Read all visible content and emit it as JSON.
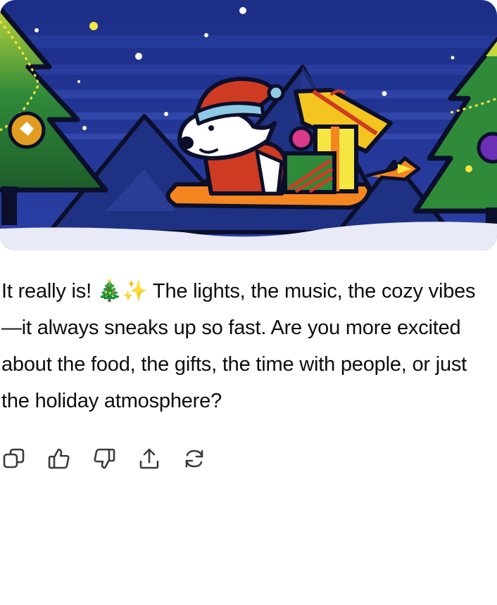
{
  "banner": {
    "icon": "christmas-sleigh-illustration"
  },
  "message": {
    "text": "It really is! 🎄✨ The lights, the music, the cozy vibes—it always sneaks up so fast. Are you more excited about the food, the gifts, the time with people, or just the holiday atmosphere?"
  },
  "actions": [
    {
      "icon": "copy-icon"
    },
    {
      "icon": "thumbs-up-icon"
    },
    {
      "icon": "thumbs-down-icon"
    },
    {
      "icon": "share-icon"
    },
    {
      "icon": "regenerate-icon"
    }
  ]
}
